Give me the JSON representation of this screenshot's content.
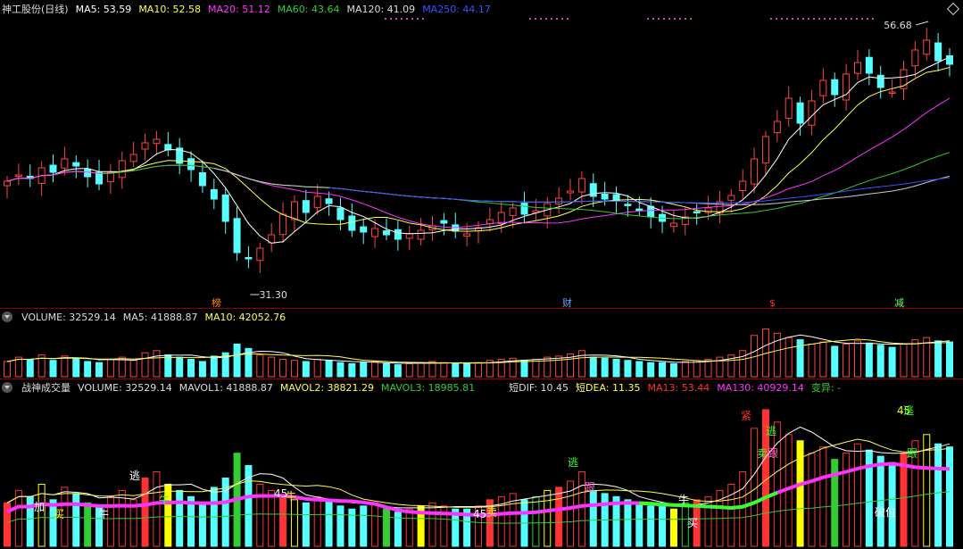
{
  "main": {
    "title": "神工股份(日线)",
    "ma": [
      {
        "label": "MA5: 53.59",
        "color": "#ffffff"
      },
      {
        "label": "MA10: 52.58",
        "color": "#ffff55"
      },
      {
        "label": "MA20: 51.12",
        "color": "#ff33ff"
      },
      {
        "label": "MA60: 43.64",
        "color": "#33cc33"
      },
      {
        "label": "MA120: 41.09",
        "color": "#ffffff"
      },
      {
        "label": "MA250: 44.17",
        "color": "#3355ff"
      }
    ],
    "high_label": "56.68",
    "low_label": "31.30",
    "markers": [
      {
        "text": "榜",
        "color": "#ff8800"
      },
      {
        "text": "财",
        "color": "#66aaff"
      },
      {
        "text": "$",
        "color": "#ff3333"
      },
      {
        "text": "减",
        "color": "#66ff66"
      }
    ]
  },
  "volume_panel": {
    "label_volume": "VOLUME: 32529.14",
    "label_ma5": "MA5: 41888.87",
    "label_ma10": "MA10: 42052.76"
  },
  "indicator_panel": {
    "name": "战神成交量",
    "volume": "VOLUME: 32529.14",
    "mavol1": "MAVOL1: 41888.87",
    "mavol2": "MAVOL2: 38821.29",
    "mavol3": "MAVOL3: 18985.81",
    "dif": "短DIF: 10.45",
    "dea": "短DEA: 11.35",
    "ma13": "MA13: 53.44",
    "ma130": "MA130: 40929.14",
    "bianyi": "变异: -",
    "signals": [
      "加",
      "买",
      "牛",
      "逃",
      "牛",
      "45",
      "牛",
      "45",
      "卖",
      "逃",
      "跟",
      "牛",
      "买",
      "紧",
      "逃",
      "卖",
      "跟",
      "45",
      "逃",
      "跟",
      "破位"
    ]
  },
  "chart_data": [
    {
      "type": "candlestick",
      "title": "神工股份(日线)",
      "y_high": 56.68,
      "y_low": 31.3,
      "close": [
        40.5,
        41.2,
        40.8,
        42.0,
        41.5,
        43.0,
        42.2,
        41.0,
        40.2,
        41.5,
        42.8,
        43.5,
        44.8,
        45.2,
        44.0,
        42.5,
        41.8,
        40.0,
        38.5,
        36.0,
        32.5,
        31.8,
        33.0,
        34.5,
        36.8,
        38.2,
        37.0,
        38.8,
        38.0,
        36.2,
        35.0,
        34.8,
        35.2,
        34.5,
        34.0,
        34.6,
        35.0,
        35.5,
        35.8,
        34.9,
        34.6,
        35.3,
        36.2,
        37.0,
        37.5,
        36.8,
        37.2,
        38.0,
        38.6,
        39.4,
        40.8,
        38.8,
        38.5,
        38.3,
        37.8,
        37.2,
        36.5,
        36.0,
        35.8,
        36.5,
        37.0,
        37.5,
        38.2,
        38.9,
        40.5,
        43.0,
        45.5,
        47.2,
        49.8,
        47.0,
        49.5,
        51.8,
        50.2,
        52.5,
        53.8,
        52.6,
        51.0,
        50.5,
        53.0,
        55.2,
        56.3,
        54.0,
        53.6
      ]
    },
    {
      "type": "bar",
      "title": "VOLUME",
      "values": [
        14,
        18,
        16,
        20,
        15,
        19,
        17,
        14,
        13,
        16,
        18,
        15,
        22,
        24,
        20,
        18,
        16,
        14,
        19,
        22,
        30,
        26,
        20,
        18,
        16,
        15,
        14,
        16,
        15,
        13,
        12,
        13,
        14,
        12,
        11,
        12,
        13,
        14,
        13,
        12,
        12,
        13,
        15,
        16,
        17,
        15,
        16,
        18,
        19,
        21,
        24,
        18,
        17,
        16,
        15,
        14,
        13,
        13,
        12,
        14,
        15,
        16,
        18,
        20,
        24,
        38,
        44,
        40,
        36,
        34,
        30,
        32,
        28,
        30,
        33,
        31,
        29,
        27,
        30,
        34,
        36,
        33,
        32
      ]
    }
  ]
}
